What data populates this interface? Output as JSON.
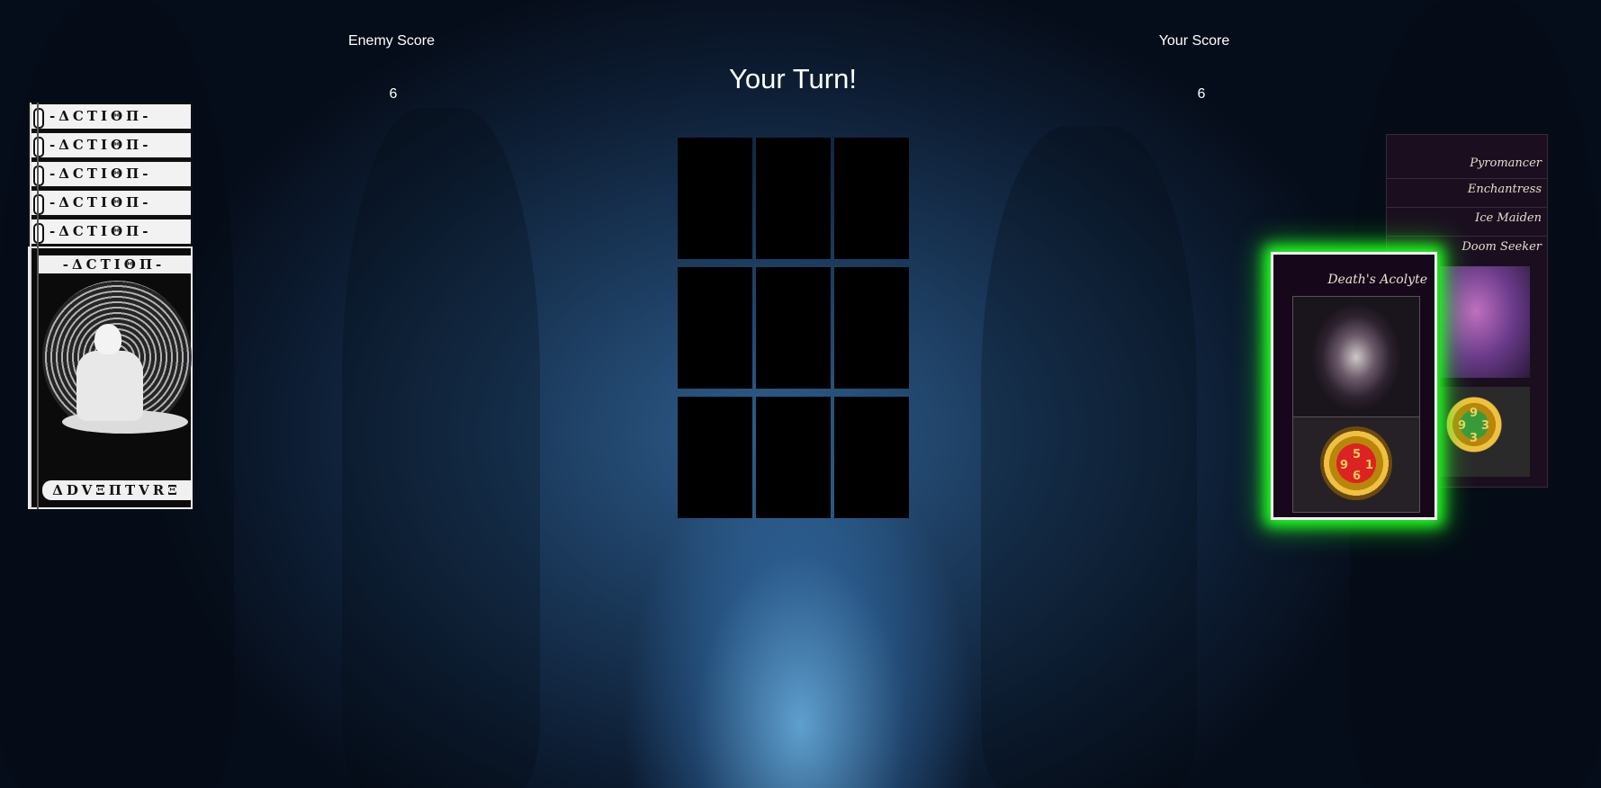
{
  "scores": {
    "enemy_label": "Enemy Score",
    "enemy_value": "6",
    "player_label": "Your Score",
    "player_value": "6"
  },
  "turn_banner": "Your Turn!",
  "board": {
    "slots": 9
  },
  "enemy_deck": {
    "strip_label": "-ΔCTIΘΠ-",
    "top_banner": "-ΔCTIΘΠ-",
    "bottom_banner": "ΔDVΞΠTVRΞ"
  },
  "hand": {
    "stacked_cards": [
      "Pyromancer",
      "Enchantress",
      "Ice Maiden",
      "Doom Seeker"
    ],
    "selected_card": {
      "name": "Death's Acolyte",
      "values": {
        "top": "5",
        "left": "9",
        "right": "1",
        "bottom": "6"
      },
      "glow_color": "#22ff22"
    },
    "peek_values": {
      "top": "9",
      "left": "9",
      "right": "3",
      "bottom": "3"
    }
  }
}
